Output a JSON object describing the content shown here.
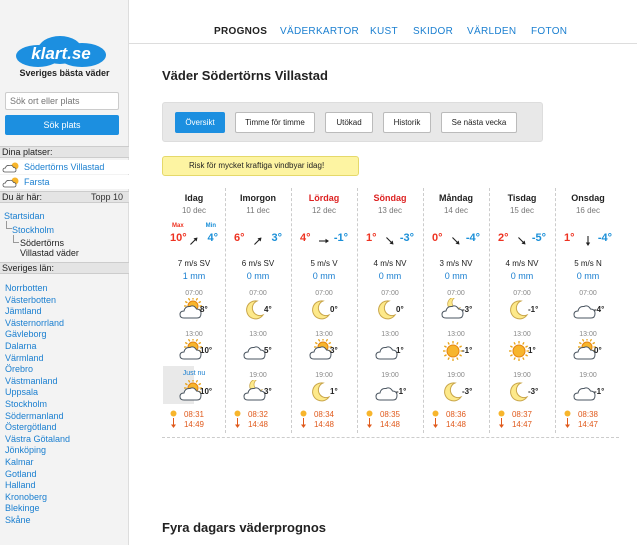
{
  "brand": {
    "logo": "klart.se",
    "tagline": "Sveriges bästa väder"
  },
  "search": {
    "placeholder": "Sök ort eller plats",
    "button": "Sök plats"
  },
  "sidebar": {
    "my_places_title": "Dina platser:",
    "my_places": [
      "Södertörns Villastad",
      "Farsta"
    ],
    "here_title": "Du är här:",
    "here_right": "Topp 10",
    "breadcrumb": [
      "Startsidan",
      "Stockholm",
      "Södertörns Villastad väder"
    ],
    "counties_title": "Sveriges län:",
    "counties": [
      "Norrbotten",
      "Västerbotten",
      "Jämtland",
      "Västernorrland",
      "Gävleborg",
      "Dalarna",
      "Värmland",
      "Örebro",
      "Västmanland",
      "Uppsala",
      "Stockholm",
      "Södermanland",
      "Östergötland",
      "Västra Götaland",
      "Jönköping",
      "Kalmar",
      "Gotland",
      "Halland",
      "Kronoberg",
      "Blekinge",
      "Skåne"
    ]
  },
  "nav": [
    "PROGNOS",
    "VÄDERKARTOR",
    "KUST",
    "SKIDOR",
    "VÄRLDEN",
    "FOTON"
  ],
  "page_title": "Väder Södertörns Villastad",
  "toolbar": [
    "Översikt",
    "Timme för timme",
    "Utökad",
    "Historik",
    "Se nästa vecka"
  ],
  "warning": "Risk för mycket kraftiga vindbyar idag!",
  "labels": {
    "max": "Max",
    "min": "Min",
    "just_nu": "Just nu",
    "t1": "07:00",
    "t2": "13:00",
    "t3": "19:00"
  },
  "days": [
    {
      "name": "Idag",
      "date": "10 dec",
      "max": "10°",
      "min": "4°",
      "wind": "7 m/s SV",
      "rain": "1 mm",
      "p1": "8°",
      "p2": "10°",
      "p3": "10°",
      "rise": "08:31",
      "set": "14:49",
      "i1": "partly",
      "i2": "partly",
      "i3": "partly",
      "red": false
    },
    {
      "name": "Imorgon",
      "date": "11 dec",
      "max": "6°",
      "min": "3°",
      "wind": "6 m/s SV",
      "rain": "0 mm",
      "p1": "4°",
      "p2": "5°",
      "p3": "3°",
      "rise": "08:32",
      "set": "14:48",
      "i1": "moon",
      "i2": "cloud",
      "i3": "mooncloud",
      "red": false
    },
    {
      "name": "Lördag",
      "date": "12 dec",
      "max": "4°",
      "min": "-1°",
      "wind": "5 m/s V",
      "rain": "0 mm",
      "p1": "0°",
      "p2": "3°",
      "p3": "1°",
      "rise": "08:34",
      "set": "14:48",
      "i1": "moon",
      "i2": "partly",
      "i3": "moon",
      "red": true
    },
    {
      "name": "Söndag",
      "date": "13 dec",
      "max": "1°",
      "min": "-3°",
      "wind": "4 m/s NV",
      "rain": "0 mm",
      "p1": "0°",
      "p2": "1°",
      "p3": "-1°",
      "rise": "08:35",
      "set": "14:48",
      "i1": "moon",
      "i2": "cloud",
      "i3": "cloud",
      "red": true
    },
    {
      "name": "Måndag",
      "date": "14 dec",
      "max": "0°",
      "min": "-4°",
      "wind": "3 m/s NV",
      "rain": "0 mm",
      "p1": "-3°",
      "p2": "-1°",
      "p3": "-3°",
      "rise": "08:36",
      "set": "14:48",
      "i1": "mooncloud",
      "i2": "sun",
      "i3": "moon",
      "red": false
    },
    {
      "name": "Tisdag",
      "date": "15 dec",
      "max": "2°",
      "min": "-5°",
      "wind": "4 m/s NV",
      "rain": "0 mm",
      "p1": "-1°",
      "p2": "1°",
      "p3": "-3°",
      "rise": "08:37",
      "set": "14:47",
      "i1": "moon",
      "i2": "sun",
      "i3": "moon",
      "red": false
    },
    {
      "name": "Onsdag",
      "date": "16 dec",
      "max": "1°",
      "min": "-4°",
      "wind": "5 m/s N",
      "rain": "0 mm",
      "p1": "-4°",
      "p2": "0°",
      "p3": "-1°",
      "rise": "08:38",
      "set": "14:47",
      "i1": "cloud",
      "i2": "partly",
      "i3": "cloud",
      "red": false
    }
  ],
  "section2_title": "Fyra dagars väderprognos",
  "colors": {
    "accent": "#1c8fe0",
    "warm": "#e32222",
    "cold": "#1a8fd8",
    "sun": "#e05a1c"
  }
}
